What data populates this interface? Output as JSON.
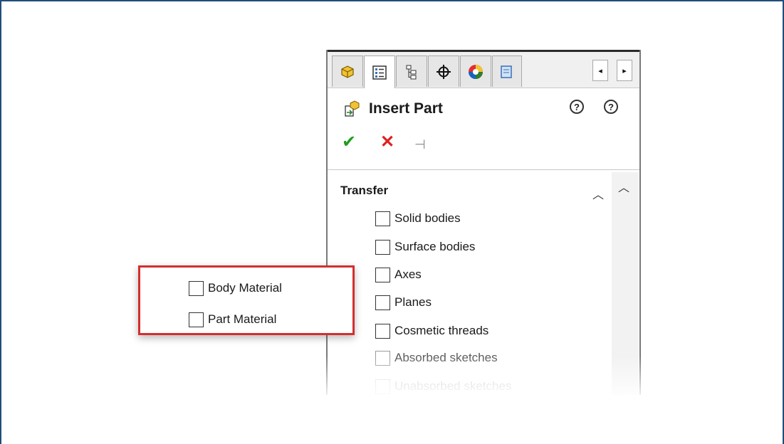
{
  "property_manager": {
    "tabs": [
      {
        "icon": "feature-manager-icon",
        "active": false
      },
      {
        "icon": "property-manager-icon",
        "active": true
      },
      {
        "icon": "configuration-manager-icon",
        "active": false
      },
      {
        "icon": "dimxpert-manager-icon",
        "active": false
      },
      {
        "icon": "display-manager-icon",
        "active": false
      },
      {
        "icon": "cam-manager-icon",
        "active": false
      }
    ],
    "tab_scroll": {
      "left": "◂",
      "right": "▸"
    },
    "title": "Insert Part",
    "help_icons": [
      "what's-new-help-icon",
      "help-icon"
    ],
    "actions": {
      "ok": "✔",
      "cancel": "✕",
      "pin": "⊣"
    },
    "section": {
      "title": "Transfer",
      "options": [
        {
          "label": "Solid bodies",
          "checked": false,
          "state": "normal"
        },
        {
          "label": "Surface bodies",
          "checked": false,
          "state": "normal"
        },
        {
          "label": "Axes",
          "checked": false,
          "state": "normal"
        },
        {
          "label": "Planes",
          "checked": false,
          "state": "normal"
        },
        {
          "label": "Cosmetic threads",
          "checked": false,
          "state": "normal"
        },
        {
          "label": "Absorbed sketches",
          "checked": false,
          "state": "dim"
        },
        {
          "label": "Unabsorbed sketches",
          "checked": false,
          "state": "faded"
        }
      ]
    }
  },
  "callout": {
    "options": [
      {
        "label": "Body Material",
        "checked": false
      },
      {
        "label": "Part Material",
        "checked": false
      }
    ],
    "border_color": "#d32f2f"
  },
  "colors": {
    "ok": "#1e9e1e",
    "cancel": "#e02020",
    "frame": "#1f4e79"
  }
}
